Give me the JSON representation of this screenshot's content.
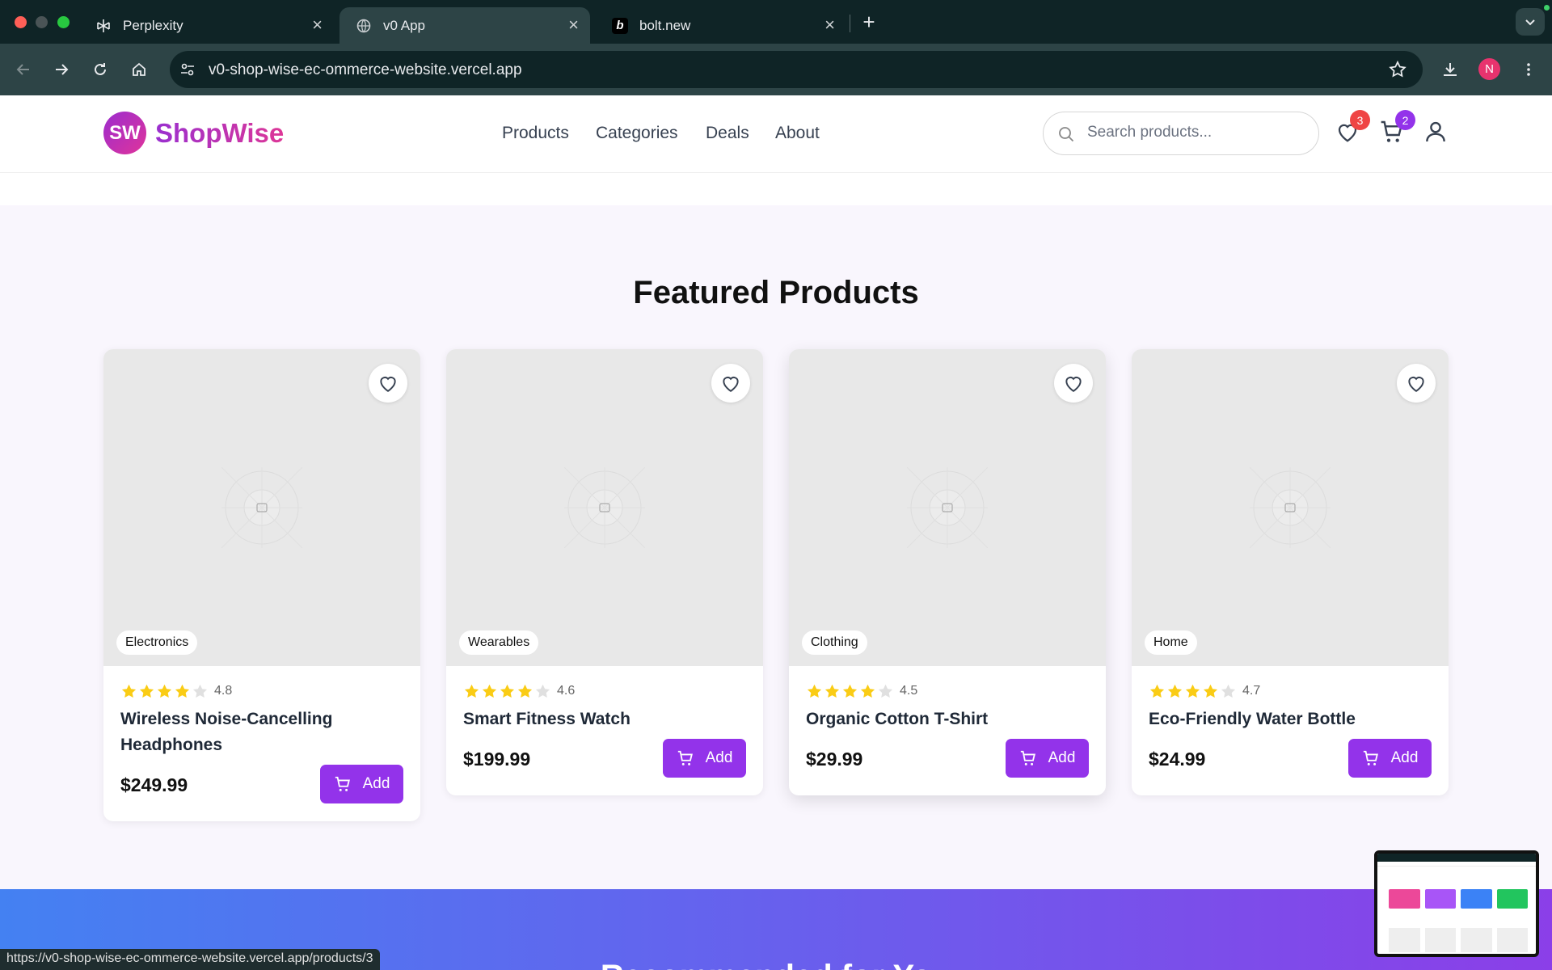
{
  "browser": {
    "tabs": [
      {
        "title": "Perplexity",
        "favicon": "perplexity-icon"
      },
      {
        "title": "v0 App",
        "favicon": "globe-icon",
        "active": true
      },
      {
        "title": "bolt.new",
        "favicon": "bolt-icon"
      }
    ],
    "url": "v0-shop-wise-ec-ommerce-website.vercel.app",
    "profile_initial": "N",
    "status_url": "https://v0-shop-wise-ec-ommerce-website.vercel.app/products/3"
  },
  "header": {
    "logo_badge": "SW",
    "logo_text": "ShopWise",
    "nav": [
      "Products",
      "Categories",
      "Deals",
      "About"
    ],
    "search_placeholder": "Search products...",
    "wishlist_count": "3",
    "cart_count": "2"
  },
  "featured": {
    "title": "Featured Products",
    "add_label": "Add",
    "products": [
      {
        "category": "Electronics",
        "rating": "4.8",
        "name": "Wireless Noise-Cancelling Headphones",
        "price": "$249.99"
      },
      {
        "category": "Wearables",
        "rating": "4.6",
        "name": "Smart Fitness Watch",
        "price": "$199.99"
      },
      {
        "category": "Clothing",
        "rating": "4.5",
        "name": "Organic Cotton T-Shirt",
        "price": "$29.99"
      },
      {
        "category": "Home",
        "rating": "4.7",
        "name": "Eco-Friendly Water Bottle",
        "price": "$24.99"
      }
    ]
  },
  "banner": {
    "title": "Recommended for You"
  },
  "colors": {
    "brand": "#9333ea",
    "star": "#facc15",
    "wishlist_badge": "#ef4444",
    "cart_badge": "#9333ea"
  }
}
